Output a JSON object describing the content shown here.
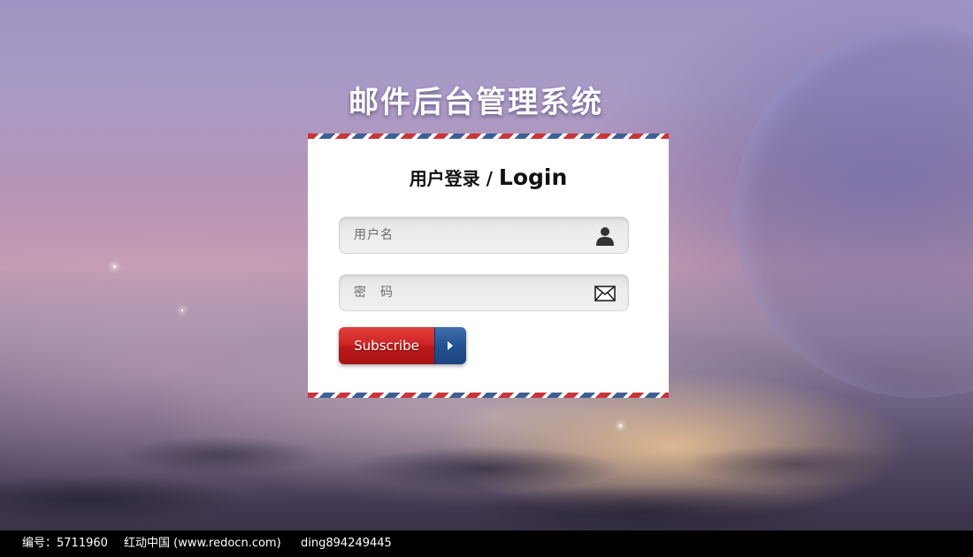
{
  "page": {
    "title": "邮件后台管理系统"
  },
  "login": {
    "heading_zh": "用户登录",
    "heading_sep": " / ",
    "heading_en": "Login",
    "username_placeholder": "用户名",
    "username_icon": "user-icon",
    "password_placeholder": "密　码",
    "password_icon": "envelope-icon",
    "submit_label": "Subscribe",
    "submit_icon": "arrow-right-icon"
  },
  "footer": {
    "id_text": "编号：5711960",
    "site_text": "红动中国 (www.redocn.com)",
    "author_text": "ding894249445"
  },
  "colors": {
    "stripe_red": "#c8353a",
    "stripe_blue": "#3f5f93",
    "button_red": "#cf2424",
    "button_blue": "#245291"
  }
}
